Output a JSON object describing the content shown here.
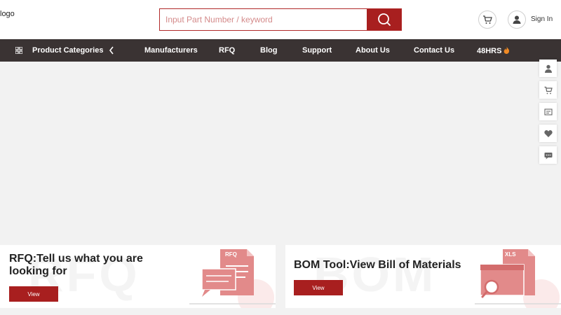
{
  "header": {
    "logo_text": "logo",
    "search": {
      "placeholder": "Input Part Number / keyword",
      "value": ""
    },
    "signin_label": "Sign In"
  },
  "nav": {
    "categories_label": "Product Categories",
    "items": [
      "Manufacturers",
      "RFQ",
      "Blog",
      "Support",
      "About Us",
      "Contact Us",
      "48HRS"
    ]
  },
  "side_tools": [
    "user-icon",
    "cart-icon",
    "document-icon",
    "heart-icon",
    "chat-icon"
  ],
  "cards": [
    {
      "watermark": "RFQ",
      "title": "RFQ:Tell us what you are looking for",
      "button_label": "View",
      "badge": "RFQ"
    },
    {
      "watermark": "BOM",
      "title": "BOM Tool:View Bill of Materials",
      "button_label": "View",
      "badge": "XLS"
    }
  ],
  "colors": {
    "brand": "#a81f1f",
    "nav_bg": "#3a3333",
    "page_bg": "#f2f2f2",
    "illustration": "#e28a8a"
  }
}
